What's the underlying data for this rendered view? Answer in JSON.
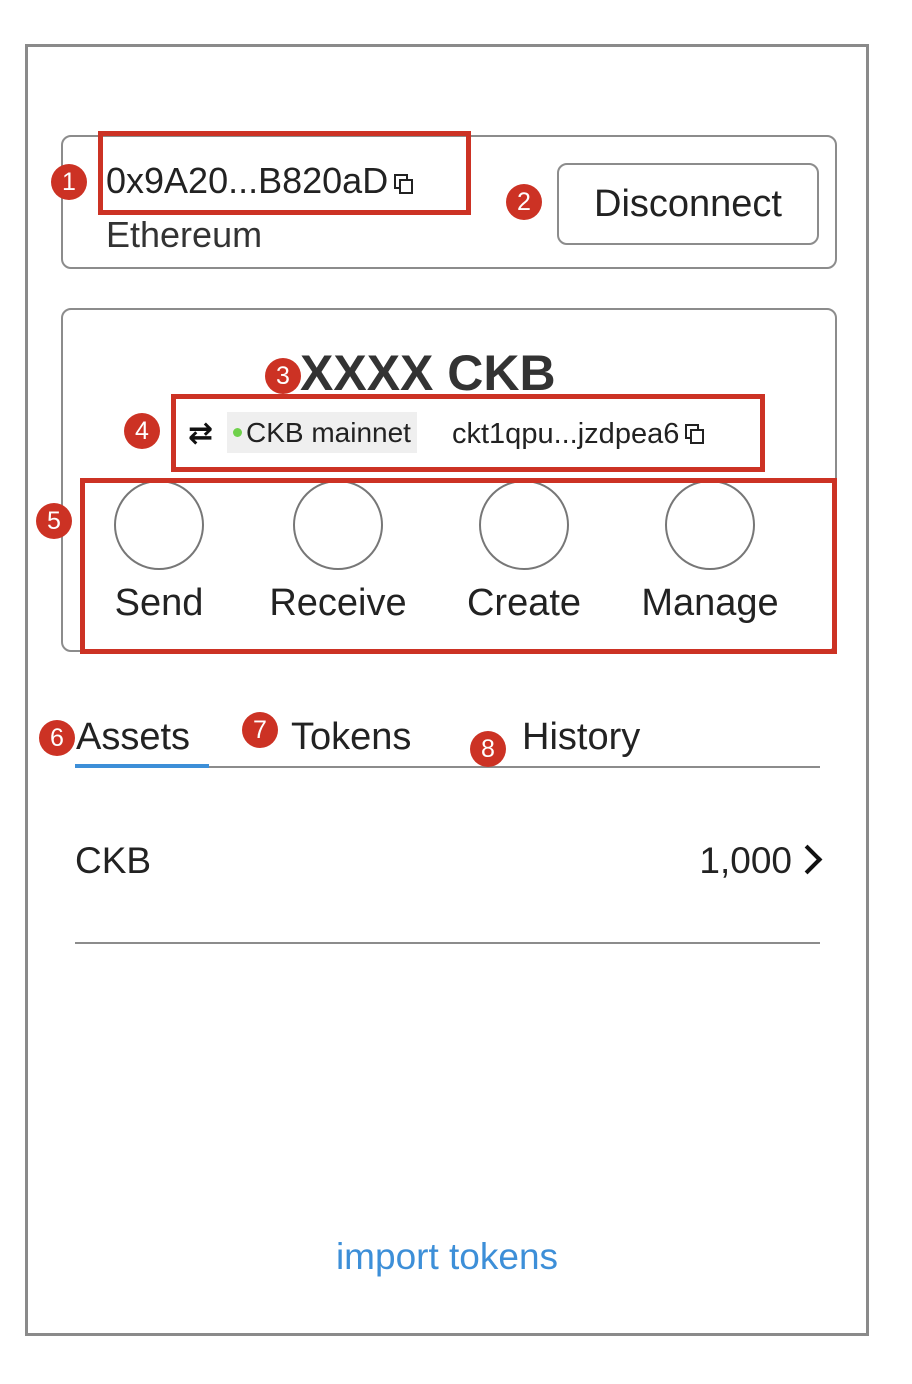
{
  "account": {
    "address": "0x9A20...B820aD",
    "network": "Ethereum",
    "disconnect_label": "Disconnect",
    "copy_icon": "copy-icon"
  },
  "balance": {
    "amount": "XXXX CKB",
    "switch_icon": "swap-arrows-icon",
    "network_label": "CKB mainnet",
    "network_status_color": "#6fd14b",
    "ckb_address": "ckt1qpu...jzdpea6"
  },
  "actions": [
    {
      "label": "Send"
    },
    {
      "label": "Receive"
    },
    {
      "label": "Create"
    },
    {
      "label": "Manage"
    }
  ],
  "tabs": [
    {
      "label": "Assets",
      "active": true
    },
    {
      "label": "Tokens",
      "active": false
    },
    {
      "label": "History",
      "active": false
    }
  ],
  "assets": [
    {
      "name": "CKB",
      "amount": "1,000"
    }
  ],
  "import_label": "import tokens",
  "annotations": [
    "1",
    "2",
    "3",
    "4",
    "5",
    "6",
    "7",
    "8"
  ],
  "colors": {
    "accent": "#3d8fd8",
    "annotation": "#cc3224"
  }
}
